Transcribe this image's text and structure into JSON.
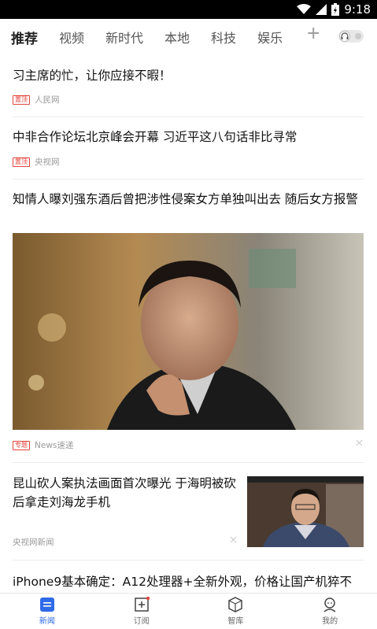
{
  "status_bar": {
    "time": "9:18"
  },
  "tabs": [
    {
      "label": "推荐"
    },
    {
      "label": "视频"
    },
    {
      "label": "新时代"
    },
    {
      "label": "本地"
    },
    {
      "label": "科技"
    },
    {
      "label": "娱乐"
    }
  ],
  "tab_add_label": "+",
  "news": [
    {
      "title": "习主席的忙，让你应接不暇！",
      "badge": "置顶",
      "source": "人民网"
    },
    {
      "title": "中非合作论坛北京峰会开幕 习近平这八句话非比寻常",
      "badge": "置顶",
      "source": "央视网"
    },
    {
      "title": "知情人曝刘强东酒后曾把涉性侵案女方单独叫出去 随后女方报警",
      "badge": "专题",
      "source": "News速递"
    },
    {
      "title": "昆山砍人案执法画面首次曝光 于海明被砍后拿走刘海龙手机",
      "source": "央视网新闻"
    },
    {
      "title": "iPhone9基本确定：A12处理器+全新外观，价格让国产机猝不"
    }
  ],
  "bottom_nav": [
    {
      "label": "新闻",
      "icon": "news-icon"
    },
    {
      "label": "订阅",
      "icon": "subscribe-icon"
    },
    {
      "label": "智库",
      "icon": "thinktank-icon"
    },
    {
      "label": "我的",
      "icon": "profile-icon"
    }
  ],
  "colors": {
    "accent": "#2f6be8",
    "badge": "#e2433d"
  }
}
